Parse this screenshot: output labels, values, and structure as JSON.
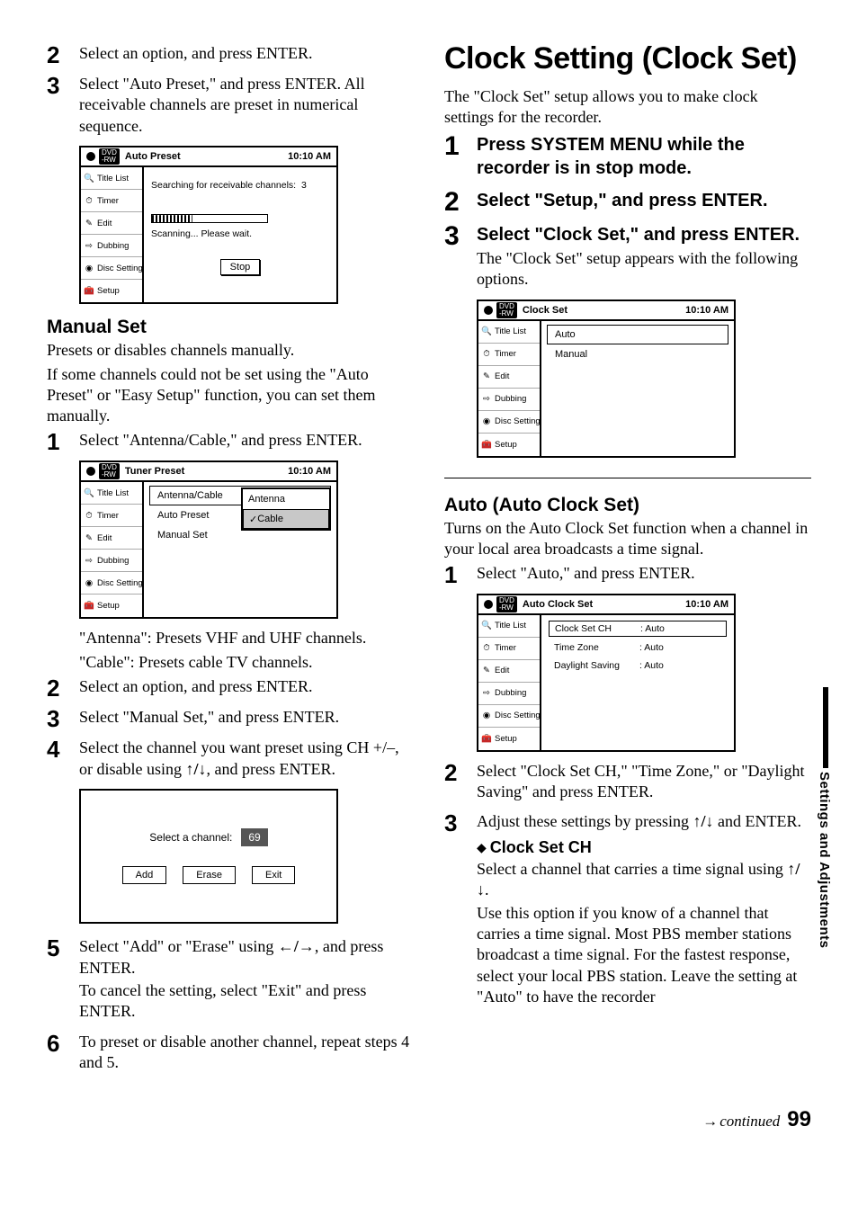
{
  "page_number": "99",
  "continued": "continued",
  "side_tab": "Settings and Adjustments",
  "sidebar_items": [
    "Title List",
    "Timer",
    "Edit",
    "Dubbing",
    "Disc Setting",
    "Setup"
  ],
  "left": {
    "step2a": "Select an option, and press ENTER.",
    "step3a": "Select \"Auto Preset,\" and press ENTER. All receivable channels are preset in numerical sequence.",
    "osd1": {
      "title": "Auto Preset",
      "time": "10:10 AM",
      "line1_prefix": "Searching for receivable channels:",
      "line1_count": "3",
      "line2": "Scanning... Please wait.",
      "btn": "Stop"
    },
    "manual_set_heading": "Manual Set",
    "ms_para1": "Presets or disables channels manually.",
    "ms_para2": "If some channels could not be set using the \"Auto Preset\" or \"Easy Setup\" function, you can set them manually.",
    "ms_step1": "Select \"Antenna/Cable,\" and press ENTER.",
    "osd2": {
      "title": "Tuner Preset",
      "time": "10:10 AM",
      "rows": [
        "Antenna/Cable",
        "Auto Preset",
        "Manual Set"
      ],
      "submenu": [
        "Antenna",
        "Cable"
      ],
      "submenu_sel": 1
    },
    "ms_step1_note1": "\"Antenna\": Presets VHF and UHF channels.",
    "ms_step1_note2": "\"Cable\": Presets cable TV channels.",
    "ms_step2": "Select an option, and press ENTER.",
    "ms_step3": "Select \"Manual Set,\" and press ENTER.",
    "ms_step4_a": "Select the channel you want preset using CH +/–, or disable using ",
    "ms_step4_b": ", and press ENTER.",
    "dlg": {
      "label": "Select a channel:",
      "ch": "69",
      "btns": [
        "Add",
        "Erase",
        "Exit"
      ]
    },
    "ms_step5_a": "Select \"Add\" or \"Erase\" using ",
    "ms_step5_b": ", and press ENTER.",
    "ms_step5_c": "To cancel the setting, select \"Exit\" and press ENTER.",
    "ms_step6": "To preset or disable another channel, repeat steps 4 and 5."
  },
  "right": {
    "title": "Clock Setting (Clock Set)",
    "intro": "The \"Clock Set\" setup allows you to make clock settings for the recorder.",
    "step1": "Press SYSTEM MENU while the recorder is in stop mode.",
    "step2": "Select \"Setup,\" and press ENTER.",
    "step3a": "Select \"Clock Set,\" and press ENTER.",
    "step3b": "The \"Clock Set\" setup appears with the following options.",
    "osd3": {
      "title": "Clock Set",
      "time": "10:10 AM",
      "items": [
        "Auto",
        "Manual"
      ],
      "sel": 0
    },
    "auto_heading": "Auto (Auto Clock Set)",
    "auto_intro": "Turns on the Auto Clock Set function when a channel in your local area broadcasts a time signal.",
    "auto_step1": "Select \"Auto,\" and press ENTER.",
    "osd4": {
      "title": "Auto Clock Set",
      "time": "10:10 AM",
      "rows": [
        {
          "label": "Clock Set CH",
          "val": ":  Auto"
        },
        {
          "label": "Time Zone",
          "val": ":  Auto"
        },
        {
          "label": "Daylight Saving",
          "val": ":  Auto"
        }
      ],
      "sel": 0
    },
    "auto_step2": "Select \"Clock Set CH,\" \"Time Zone,\" or \"Daylight Saving\" and press ENTER.",
    "auto_step3_a": "Adjust these settings by pressing ",
    "auto_step3_b": " and ENTER.",
    "sub1_label": "Clock Set CH",
    "sub1_line1_a": "Select a channel that carries a time signal using ",
    "sub1_line1_b": ".",
    "sub1_line2": "Use this option if you know of a channel that carries a time signal. Most PBS member stations broadcast a time signal. For the fastest response, select your local PBS station. Leave the setting at \"Auto\" to have the recorder"
  }
}
